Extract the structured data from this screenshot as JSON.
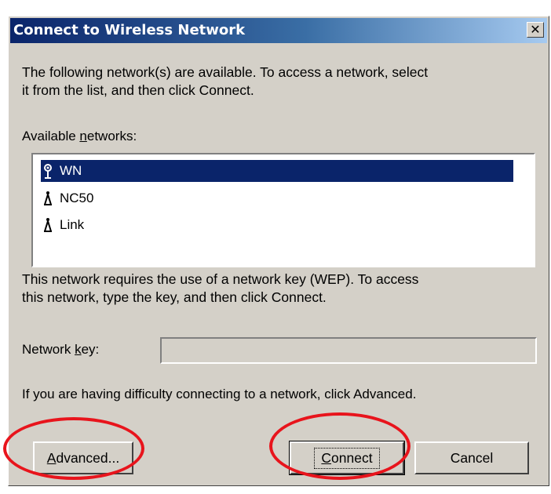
{
  "window": {
    "title": "Connect to Wireless Network",
    "close_label": "✕"
  },
  "intro": {
    "line1": "The following network(s) are available. To access a network, select",
    "line2": "it from the list, and then click Connect."
  },
  "networks_label": {
    "before": "Available ",
    "mnemonic": "n",
    "after": "etworks:"
  },
  "networks": [
    {
      "name": "WN",
      "selected": true,
      "icon": "antenna-icon"
    },
    {
      "name": "NC50",
      "selected": false,
      "icon": "network-tower-icon"
    },
    {
      "name": "Link",
      "selected": false,
      "icon": "network-tower-icon"
    }
  ],
  "wep_note": {
    "line1": "This network requires the use of a network key (WEP). To access",
    "line2": "this network, type the key, and then click Connect."
  },
  "key_label": {
    "before": "Network ",
    "mnemonic": "k",
    "after": "ey:"
  },
  "key_field": {
    "value": ""
  },
  "advanced_note": "If you are having difficulty connecting to a network, click Advanced.",
  "buttons": {
    "advanced": {
      "mnemonic": "A",
      "rest": "dvanced..."
    },
    "connect": {
      "mnemonic": "C",
      "rest": "onnect"
    },
    "cancel": "Cancel"
  },
  "colors": {
    "selection": "#0a246a",
    "annotation_circle": "#e8141c",
    "dialog_face": "#d4d0c8"
  }
}
